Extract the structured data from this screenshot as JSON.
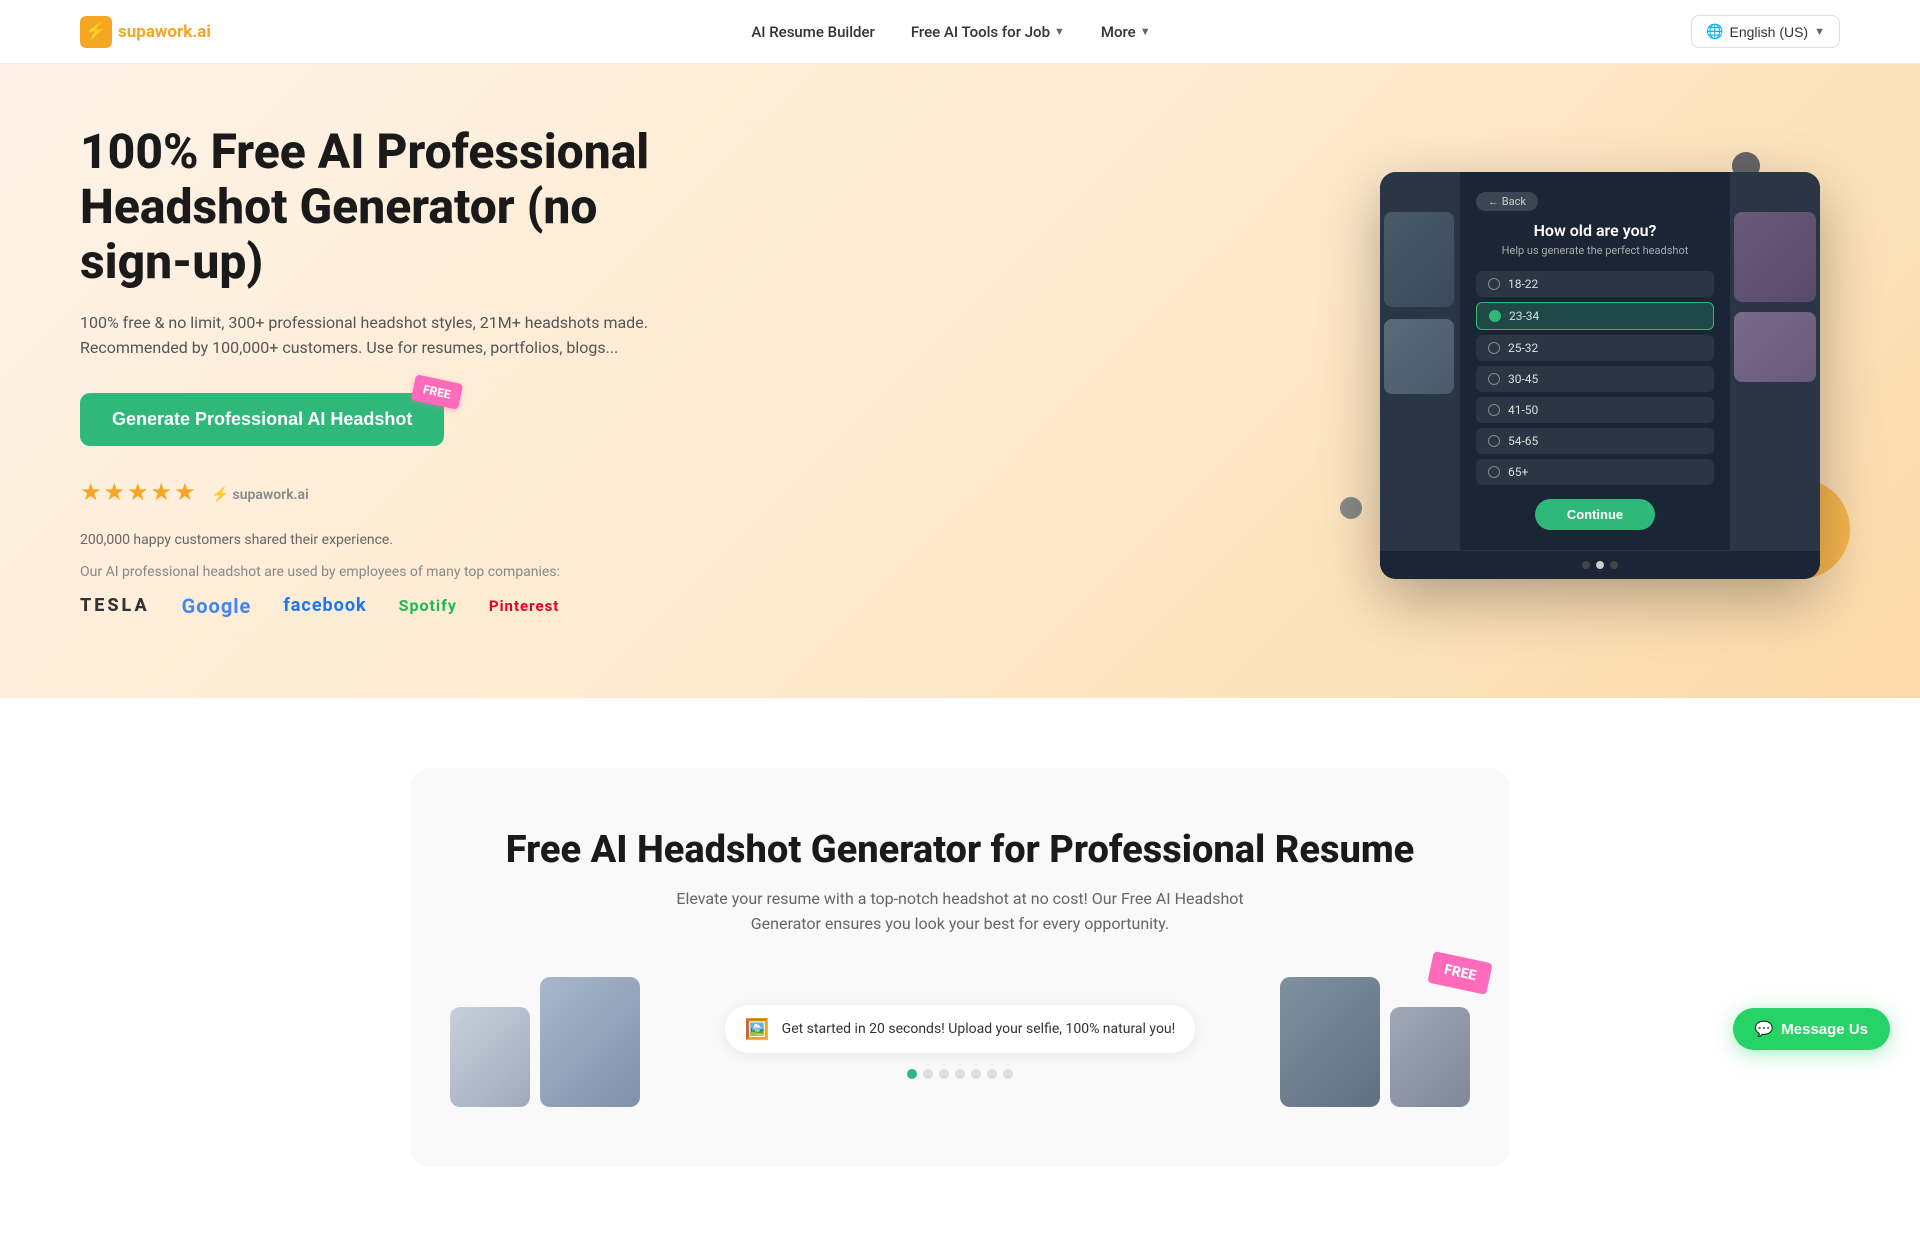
{
  "nav": {
    "logo_text": "supawork",
    "logo_suffix": ".ai",
    "links": [
      {
        "label": "AI Resume Builder",
        "has_chevron": false
      },
      {
        "label": "Free AI Tools for Job",
        "has_chevron": true
      },
      {
        "label": "More",
        "has_chevron": true
      }
    ],
    "language": "English (US)"
  },
  "hero": {
    "title": "100% Free AI Professional Headshot Generator (no sign-up)",
    "subtitle": "100% free & no limit, 300+ professional headshot styles, 21M+ headshots made. Recommended by 100,000+ customers. Use for resumes, portfolios, blogs...",
    "cta_label": "Generate Professional AI Headshot",
    "cta_badge": "FREE",
    "ratings_text": "200,000 happy customers shared their experience.",
    "used_by": "Our AI professional headshot are used by employees of many top companies:",
    "brands": [
      "TESLA",
      "Google",
      "facebook",
      "Spotify",
      "Pinterest"
    ],
    "mockup": {
      "back_label": "← Back",
      "question": "How old are you?",
      "question_sub": "Help us generate the perfect headshot",
      "options": [
        {
          "label": "18-22",
          "selected": false
        },
        {
          "label": "23-34",
          "selected": true
        },
        {
          "label": "25-32",
          "selected": false
        },
        {
          "label": "30-45",
          "selected": false
        },
        {
          "label": "41-50",
          "selected": false
        },
        {
          "label": "54-65",
          "selected": false
        },
        {
          "label": "65+",
          "selected": false
        }
      ],
      "continue_label": "Continue"
    }
  },
  "section2": {
    "title": "Free AI Headshot Generator for Professional Resume",
    "subtitle": "Elevate your resume with a top-notch headshot at no cost! Our Free AI Headshot Generator ensures you look your best for every opportunity.",
    "step_text": "Get started in 20 seconds! Upload your selfie, 100% natural you!",
    "free_badge": "FREE"
  },
  "whatsapp": {
    "label": "Message Us"
  }
}
